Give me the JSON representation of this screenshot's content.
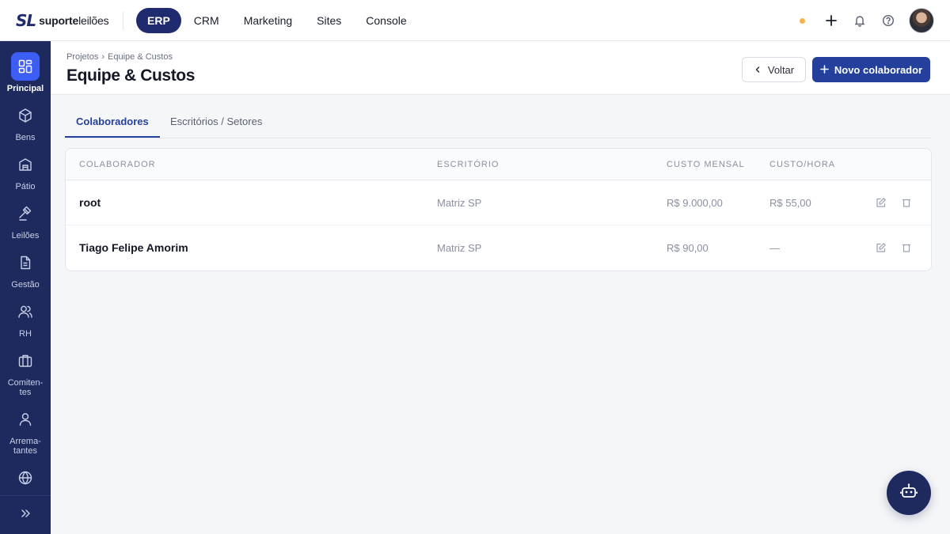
{
  "brand": {
    "mark": "SL",
    "name_bold": "suporte",
    "name_rest": "leilões"
  },
  "topnav": {
    "items": [
      {
        "label": "ERP",
        "active": true
      },
      {
        "label": "CRM",
        "active": false
      },
      {
        "label": "Marketing",
        "active": false
      },
      {
        "label": "Sites",
        "active": false
      },
      {
        "label": "Console",
        "active": false
      }
    ]
  },
  "topbar_icons": [
    "status-dot",
    "plus-icon",
    "bell-icon",
    "help-icon",
    "avatar"
  ],
  "sidebar": {
    "items": [
      {
        "label": "Principal",
        "icon": "dashboard-grid-icon",
        "active": true
      },
      {
        "label": "Bens",
        "icon": "box-icon"
      },
      {
        "label": "Pátio",
        "icon": "warehouse-icon"
      },
      {
        "label": "Leilões",
        "icon": "gavel-icon"
      },
      {
        "label": "Gestão",
        "icon": "document-icon"
      },
      {
        "label": "RH",
        "icon": "users-icon"
      },
      {
        "label": "Comiten-tes",
        "icon": "briefcase-icon"
      },
      {
        "label": "Arrema-tantes",
        "icon": "user-icon"
      },
      {
        "label": "",
        "icon": "globe-icon"
      }
    ],
    "collapse_icon": "double-chevron-right-icon"
  },
  "header": {
    "breadcrumb": [
      "Projetos",
      "›",
      "Equipe & Custos"
    ],
    "title": "Equipe & Custos",
    "back_label": "Voltar",
    "new_label": "Novo colaborador"
  },
  "tabs": [
    {
      "label": "Colaboradores",
      "active": true
    },
    {
      "label": "Escritórios / Setores",
      "active": false
    }
  ],
  "table": {
    "columns": [
      "COLABORADOR",
      "ESCRITÓRIO",
      "CUSTO MENSAL",
      "CUSTO/HORA"
    ],
    "rows": [
      {
        "colaborador": "root",
        "escritorio": "Matriz SP",
        "custo_mensal": "R$ 9.000,00",
        "custo_hora": "R$ 55,00"
      },
      {
        "colaborador": "Tiago Felipe Amorim",
        "escritorio": "Matriz SP",
        "custo_mensal": "R$ 90,00",
        "custo_hora": "—"
      }
    ]
  },
  "colors": {
    "navy": "#1e2a5e",
    "primary": "#24409c",
    "active_icon_bg": "#3d5ef5",
    "status_dot": "#f3b24a"
  }
}
